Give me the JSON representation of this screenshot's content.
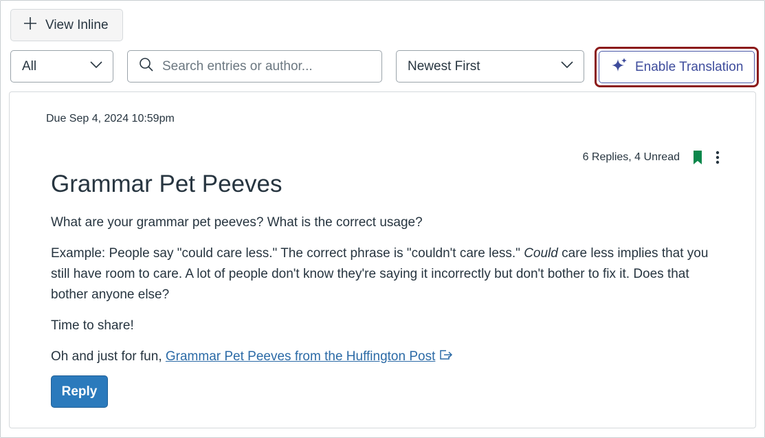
{
  "toolbar": {
    "view_inline_label": "View Inline",
    "filter_value": "All",
    "search_placeholder": "Search entries or author...",
    "sort_value": "Newest First",
    "translate_label": "Enable Translation"
  },
  "topic": {
    "due": "Due Sep 4, 2024 10:59pm",
    "replies": "6 Replies, 4 Unread",
    "title": "Grammar Pet Peeves",
    "p1": "What are your grammar pet peeves? What is the correct usage?",
    "p2_a": "Example: People say \"could care less.\" The correct phrase is \"couldn't care less.\" ",
    "p2_em": "Could",
    "p2_b": " care less implies that you still have room to care. A lot of people don't know they're saying it incorrectly but don't bother to fix it. Does that bother anyone else?",
    "p3": "Time to share!",
    "p4_prefix": "Oh and just for fun, ",
    "p4_link": "Grammar Pet Peeves from the Huffington Post",
    "reply_label": "Reply"
  },
  "colors": {
    "accent": "#2b7abc",
    "bookmark": "#0b874b",
    "highlight": "#8b1a1a",
    "translate": "#3e4c9c"
  },
  "icons": [
    "plus-icon",
    "chevron-down-icon",
    "search-icon",
    "sparkle-icon",
    "bookmark-icon",
    "kebab-icon",
    "external-link-icon"
  ]
}
